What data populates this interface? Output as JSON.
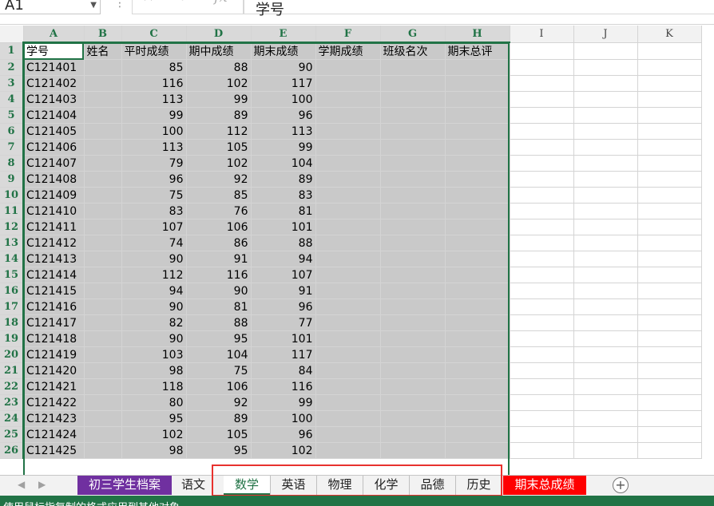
{
  "formula_bar": {
    "name_box": "A1",
    "cancel_icon": "x-icon",
    "enter_icon": "check-icon",
    "fx_label": "fx",
    "content": "学号"
  },
  "columns": [
    "A",
    "B",
    "C",
    "D",
    "E",
    "F",
    "G",
    "H",
    "I",
    "J",
    "K"
  ],
  "headers": [
    "学号",
    "姓名",
    "平时成绩",
    "期中成绩",
    "期末成绩",
    "学期成绩",
    "班级名次",
    "期末总评"
  ],
  "rows": [
    [
      "C121401",
      "",
      85,
      88,
      90
    ],
    [
      "C121402",
      "",
      116,
      102,
      117
    ],
    [
      "C121403",
      "",
      113,
      99,
      100
    ],
    [
      "C121404",
      "",
      99,
      89,
      96
    ],
    [
      "C121405",
      "",
      100,
      112,
      113
    ],
    [
      "C121406",
      "",
      113,
      105,
      99
    ],
    [
      "C121407",
      "",
      79,
      102,
      104
    ],
    [
      "C121408",
      "",
      96,
      92,
      89
    ],
    [
      "C121409",
      "",
      75,
      85,
      83
    ],
    [
      "C121410",
      "",
      83,
      76,
      81
    ],
    [
      "C121411",
      "",
      107,
      106,
      101
    ],
    [
      "C121412",
      "",
      74,
      86,
      88
    ],
    [
      "C121413",
      "",
      90,
      91,
      94
    ],
    [
      "C121414",
      "",
      112,
      116,
      107
    ],
    [
      "C121415",
      "",
      94,
      90,
      91
    ],
    [
      "C121416",
      "",
      90,
      81,
      96
    ],
    [
      "C121417",
      "",
      82,
      88,
      77
    ],
    [
      "C121418",
      "",
      90,
      95,
      101
    ],
    [
      "C121419",
      "",
      103,
      104,
      117
    ],
    [
      "C121420",
      "",
      98,
      75,
      84
    ],
    [
      "C121421",
      "",
      118,
      106,
      116
    ],
    [
      "C121422",
      "",
      80,
      92,
      99
    ],
    [
      "C121423",
      "",
      95,
      89,
      100
    ],
    [
      "C121424",
      "",
      102,
      105,
      96
    ],
    [
      "C121425",
      "",
      98,
      95,
      102
    ]
  ],
  "sheet_tabs": [
    {
      "label": "初三学生档案",
      "style": "purple"
    },
    {
      "label": "语文",
      "style": "normal"
    },
    {
      "label": "数学",
      "style": "active"
    },
    {
      "label": "英语",
      "style": "normal"
    },
    {
      "label": "物理",
      "style": "normal"
    },
    {
      "label": "化学",
      "style": "normal"
    },
    {
      "label": "品德",
      "style": "normal"
    },
    {
      "label": "历史",
      "style": "normal"
    },
    {
      "label": "期末总成绩",
      "style": "red"
    }
  ],
  "add_sheet_icon": "plus-circle-icon",
  "status_text": "使用鼠标指复制的格式应用到其他对象",
  "colors": {
    "accent": "#217346",
    "selection": "#c9c9c9",
    "purple_tab": "#7030a0",
    "red_tab": "#ff0000",
    "highlight_box": "#e8322e"
  }
}
